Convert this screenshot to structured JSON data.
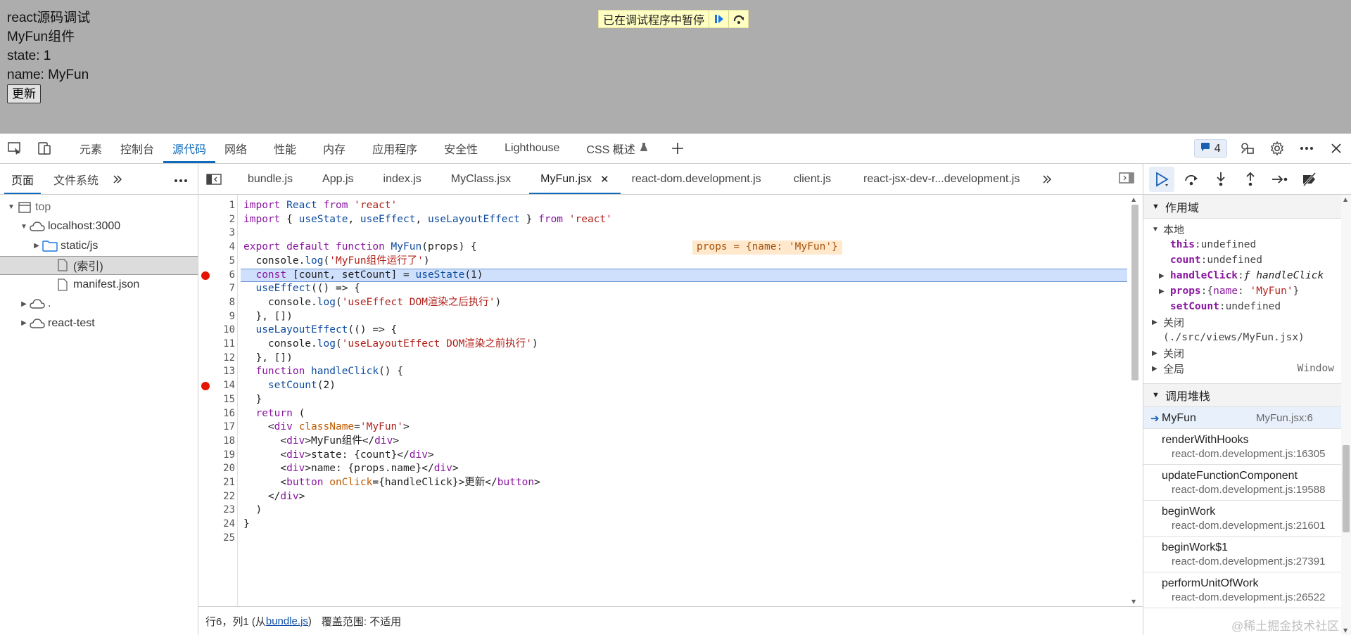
{
  "page": {
    "heading": "react源码调试",
    "component_name": "MyFun组件",
    "state_line": "state: 1",
    "name_line": "name: MyFun",
    "update_button": "更新"
  },
  "paused_banner": {
    "text": "已在调试程序中暂停",
    "resume_icon": "resume-icon",
    "step_over_icon": "step-over-icon"
  },
  "main_tabs": [
    "元素",
    "控制台",
    "源代码",
    "网络",
    "性能",
    "内存",
    "应用程序",
    "安全性",
    "Lighthouse",
    "CSS 概述"
  ],
  "active_main_tab": "源代码",
  "issues_count": "4",
  "left_tabs": [
    "页面",
    "文件系统"
  ],
  "file_tree": [
    {
      "label": "top",
      "depth": 0,
      "expanded": true,
      "icon": "frame-icon"
    },
    {
      "label": "localhost:3000",
      "depth": 1,
      "expanded": true,
      "icon": "cloud-icon"
    },
    {
      "label": "static/js",
      "depth": 2,
      "expanded": false,
      "icon": "folder-icon"
    },
    {
      "label": "(索引)",
      "depth": 3,
      "selected": true,
      "icon": "file-icon"
    },
    {
      "label": "manifest.json",
      "depth": 3,
      "icon": "file-icon"
    },
    {
      "label": ".",
      "depth": 1,
      "expanded": false,
      "icon": "cloud-icon"
    },
    {
      "label": "react-test",
      "depth": 1,
      "expanded": false,
      "icon": "cloud-icon"
    }
  ],
  "editor_tabs": [
    "bundle.js",
    "App.js",
    "index.js",
    "MyClass.jsx",
    "MyFun.jsx",
    "react-dom.development.js",
    "client.js",
    "react-jsx-dev-r...development.js"
  ],
  "active_editor_tab": "MyFun.jsx",
  "code": {
    "highlighted_line": 6,
    "breakpoints": [
      6,
      14
    ],
    "inline_hint": "props = {name: 'MyFun'}",
    "lines": [
      "import React from 'react'",
      "import { useState, useEffect, useLayoutEffect } from 'react'",
      "",
      "export default function MyFun(props) {",
      "  console.log('MyFun组件运行了')",
      "  const [count, setCount] = useState(1)",
      "  useEffect(() => {",
      "    console.log('useEffect DOM渲染之后执行')",
      "  }, [])",
      "  useLayoutEffect(() => {",
      "    console.log('useLayoutEffect DOM渲染之前执行')",
      "  }, [])",
      "  function handleClick() {",
      "    setCount(2)",
      "  }",
      "  return (",
      "    <div className='MyFun'>",
      "      <div>MyFun组件</div>",
      "      <div>state: {count}</div>",
      "      <div>name: {props.name}</div>",
      "      <button onClick={handleClick}>更新</button>",
      "    </div>",
      "  )",
      "}",
      ""
    ]
  },
  "status_bar": {
    "position": "行6，列1 (从",
    "source_link": "bundle.js",
    "close_paren": ")",
    "coverage": "覆盖范围: 不适用"
  },
  "scope": {
    "title": "作用域",
    "local_label": "本地",
    "vars": [
      {
        "key": "this",
        "value": "undefined",
        "expandable": false
      },
      {
        "key": "count",
        "value": "undefined",
        "expandable": false
      },
      {
        "key": "handleClick",
        "value": "ƒ handleClick",
        "expandable": true
      },
      {
        "key": "props",
        "value": "{name: 'MyFun'}",
        "expandable": true
      },
      {
        "key": "setCount",
        "value": "undefined",
        "expandable": false
      }
    ],
    "closure1_label": "关闭",
    "closure1_path": "(./src/views/MyFun.jsx)",
    "closure2_label": "关闭",
    "global_label": "全局",
    "global_value": "Window"
  },
  "call_stack": {
    "title": "调用堆栈",
    "current": {
      "name": "MyFun",
      "location": "MyFun.jsx:6"
    },
    "frames": [
      {
        "name": "renderWithHooks",
        "location": "react-dom.development.js:16305"
      },
      {
        "name": "updateFunctionComponent",
        "location": "react-dom.development.js:19588"
      },
      {
        "name": "beginWork",
        "location": "react-dom.development.js:21601"
      },
      {
        "name": "beginWork$1",
        "location": "react-dom.development.js:27391"
      },
      {
        "name": "performUnitOfWork",
        "location": "react-dom.development.js:26522"
      }
    ]
  },
  "watermark": "@稀土掘金技术社区"
}
